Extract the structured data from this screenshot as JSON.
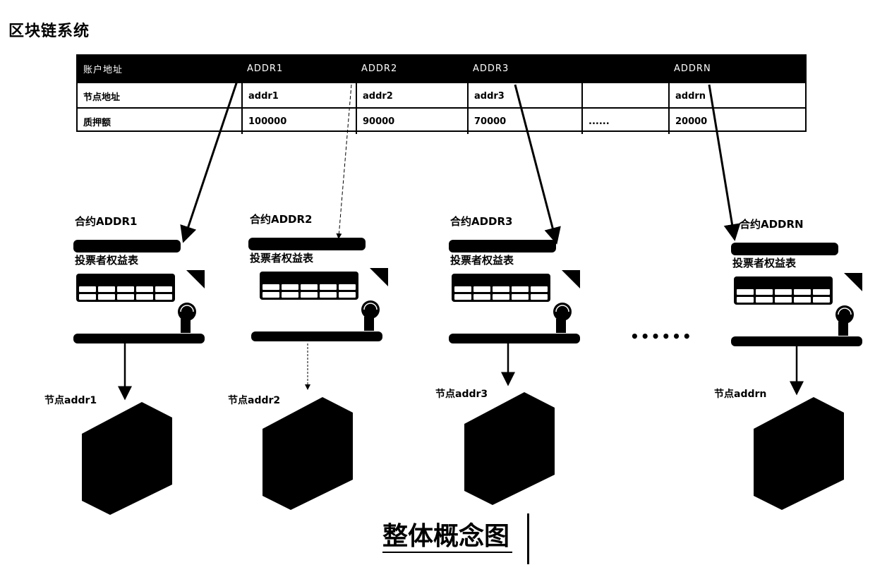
{
  "system_title": "区块链系统",
  "ledger": {
    "header": [
      "账户地址",
      "ADDR1",
      "ADDR2",
      "ADDR3",
      "",
      "ADDRN"
    ],
    "rows": [
      [
        "节点地址",
        "addr1",
        "addr2",
        "addr3",
        "",
        "addrn"
      ],
      [
        "质押额",
        "100000",
        "90000",
        "70000",
        "......",
        "20000"
      ]
    ]
  },
  "contracts": [
    {
      "label": "合约ADDR1",
      "table_title": "投票者权益表",
      "node_label": "节点addr1",
      "link_style": "solid"
    },
    {
      "label": "合约ADDR2",
      "table_title": "投票者权益表",
      "node_label": "节点addr2",
      "link_style": "dashed"
    },
    {
      "label": "合约ADDR3",
      "table_title": "投票者权益表",
      "node_label": "节点addr3",
      "link_style": "solid"
    },
    {
      "label": "合约ADDRN",
      "table_title": "投票者权益表",
      "node_label": "节点addrn",
      "link_style": "solid"
    }
  ],
  "ellipsis": "••••••",
  "icons": {
    "seal": "certificate-seal-icon",
    "server": "server-node-icon",
    "corner": "document-corner-icon"
  },
  "caption": "整体概念图",
  "colors": {
    "ink": "#000000",
    "paper": "#ffffff"
  }
}
